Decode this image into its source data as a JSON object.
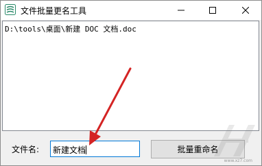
{
  "window": {
    "title": "文件批量更名工具"
  },
  "list": {
    "items": [
      "D:\\tools\\桌面\\新建 DOC 文档.doc"
    ]
  },
  "form": {
    "filename_label": "文件名:",
    "filename_value": "新建文档",
    "rename_button": "批量重命名"
  },
  "watermark": {
    "site": "www.xz7.com"
  },
  "colors": {
    "arrow": "#d42424",
    "focus_border": "#0078d7",
    "icon": "#2a8a6a"
  }
}
